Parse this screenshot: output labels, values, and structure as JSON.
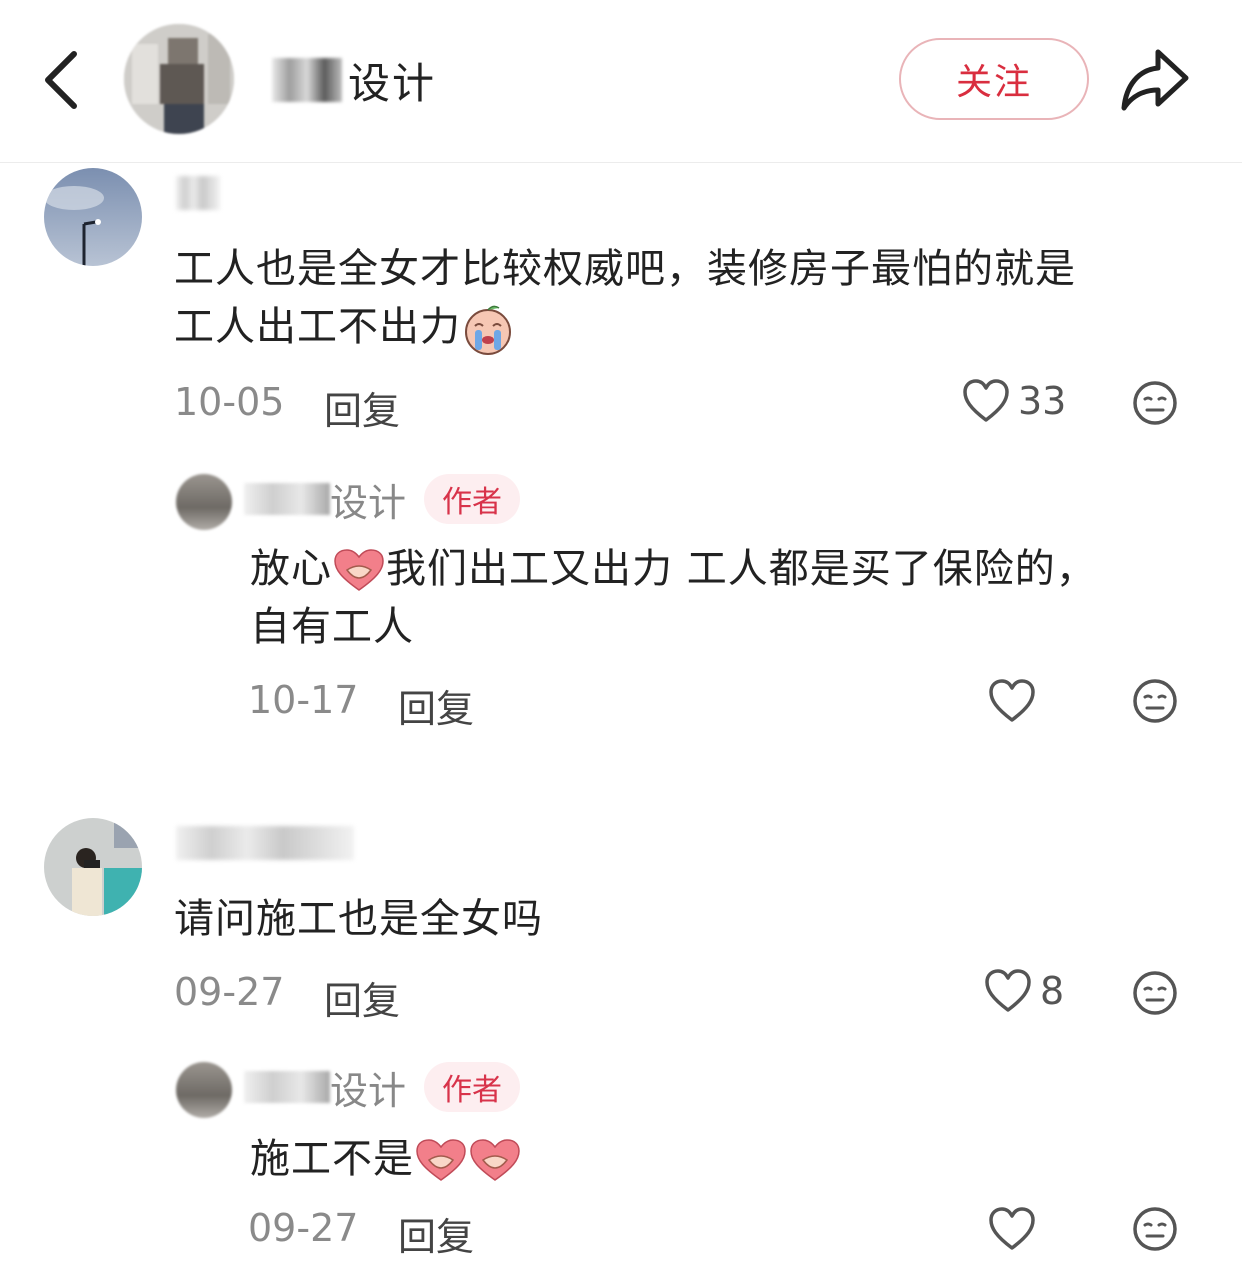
{
  "header": {
    "account_name_suffix": "设计",
    "follow_label": "关注"
  },
  "comments": [
    {
      "text_line1": "工人也是全女才比较权威吧，装修房子最怕的就是",
      "text_line2": "工人出工不出力",
      "date": "10-05",
      "reply_label": "回复",
      "likes": "33",
      "reply": {
        "author_suffix": "设计",
        "badge": "作者",
        "text_line1a": "放心",
        "text_line1b": "我们出工又出力 工人都是买了保险的，",
        "text_line2": "自有工人",
        "date": "10-17",
        "reply_label": "回复"
      }
    },
    {
      "text_line1": "请问施工也是全女吗",
      "date": "09-27",
      "reply_label": "回复",
      "likes": "8",
      "reply": {
        "author_suffix": "设计",
        "badge": "作者",
        "text_line1": "施工不是",
        "date": "09-27",
        "reply_label": "回复"
      }
    }
  ],
  "icons": {
    "back": "chevron-left-icon",
    "share": "share-arrow-icon",
    "like": "heart-outline-icon",
    "more": "neutral-face-icon"
  },
  "colors": {
    "accent": "#d92e3f",
    "badge_bg": "#fdeef0",
    "follow_border": "#e9b4b8"
  }
}
